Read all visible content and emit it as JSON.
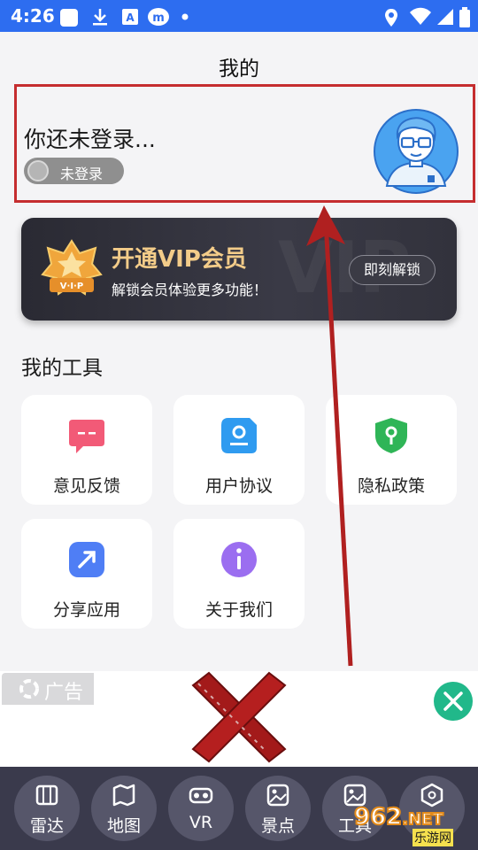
{
  "status_bar": {
    "time": "4:26",
    "left_icons": [
      "notification-square-icon",
      "download-icon",
      "a-icon",
      "m-app-icon",
      "dot-icon"
    ],
    "right_icons": [
      "location-icon",
      "wifi-icon",
      "signal-icon",
      "battery-icon"
    ]
  },
  "page": {
    "title": "我的"
  },
  "login": {
    "hint": "你还未登录...",
    "badge": "未登录"
  },
  "vip": {
    "badge_text": "V·I·P",
    "title": "开通VIP会员",
    "subtitle": "解锁会员体验更多功能！",
    "button": "即刻解锁",
    "watermark": "VIP"
  },
  "tools": {
    "title": "我的工具",
    "items": [
      {
        "label": "意见反馈",
        "icon": "feedback-icon",
        "color": "#f25a77"
      },
      {
        "label": "用户协议",
        "icon": "user-agreement-icon",
        "color": "#2f9bf0"
      },
      {
        "label": "隐私政策",
        "icon": "privacy-shield-icon",
        "color": "#2fb557"
      },
      {
        "label": "分享应用",
        "icon": "share-icon",
        "color": "#4f7ef5"
      },
      {
        "label": "关于我们",
        "icon": "info-icon",
        "color": "#9b6ef0"
      }
    ]
  },
  "ad": {
    "tag": "广告",
    "close_icon": "close-icon",
    "close_color": "#21b88a"
  },
  "bottom_nav": {
    "items": [
      {
        "label": "雷达",
        "icon": "radar-map-icon"
      },
      {
        "label": "地图",
        "icon": "map-icon"
      },
      {
        "label": "VR",
        "icon": "vr-icon"
      },
      {
        "label": "景点",
        "icon": "scenic-icon"
      },
      {
        "label": "工具",
        "icon": "tools-icon"
      },
      {
        "label": "",
        "icon": "hexagon-icon"
      }
    ]
  },
  "watermark": {
    "number": "962",
    "suffix": ".NET",
    "text": "乐游网"
  },
  "colors": {
    "status_bar": "#2d6df0",
    "highlight_box": "#c52d2f",
    "vip_gold": "#f3cc89",
    "nav_bg": "#3a3a4c"
  }
}
